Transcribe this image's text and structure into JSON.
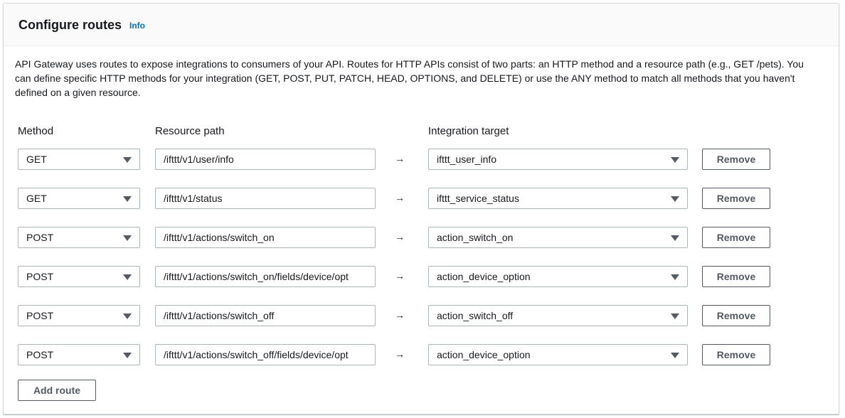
{
  "header": {
    "title": "Configure routes",
    "info_link": "Info"
  },
  "description": "API Gateway uses routes to expose integrations to consumers of your API. Routes for HTTP APIs consist of two parts: an HTTP method and a resource path (e.g., GET /pets). You can define specific HTTP methods for your integration (GET, POST, PUT, PATCH, HEAD, OPTIONS, and DELETE) or use the ANY method to match all methods that you haven't defined on a given resource.",
  "columns": {
    "method": "Method",
    "path": "Resource path",
    "target": "Integration target"
  },
  "arrow": "→",
  "routes": [
    {
      "method": "GET",
      "path": "/ifttt/v1/user/info",
      "target": "ifttt_user_info",
      "remove": "Remove"
    },
    {
      "method": "GET",
      "path": "/ifttt/v1/status",
      "target": "ifttt_service_status",
      "remove": "Remove"
    },
    {
      "method": "POST",
      "path": "/ifttt/v1/actions/switch_on",
      "target": "action_switch_on",
      "remove": "Remove"
    },
    {
      "method": "POST",
      "path": "/ifttt/v1/actions/switch_on/fields/device/opt",
      "target": "action_device_option",
      "remove": "Remove"
    },
    {
      "method": "POST",
      "path": "/ifttt/v1/actions/switch_off",
      "target": "action_switch_off",
      "remove": "Remove"
    },
    {
      "method": "POST",
      "path": "/ifttt/v1/actions/switch_off/fields/device/opt",
      "target": "action_device_option",
      "remove": "Remove"
    }
  ],
  "add_route_label": "Add route",
  "icons": {
    "dropdown": "caret-down-icon",
    "arrow": "right-arrow-icon"
  }
}
